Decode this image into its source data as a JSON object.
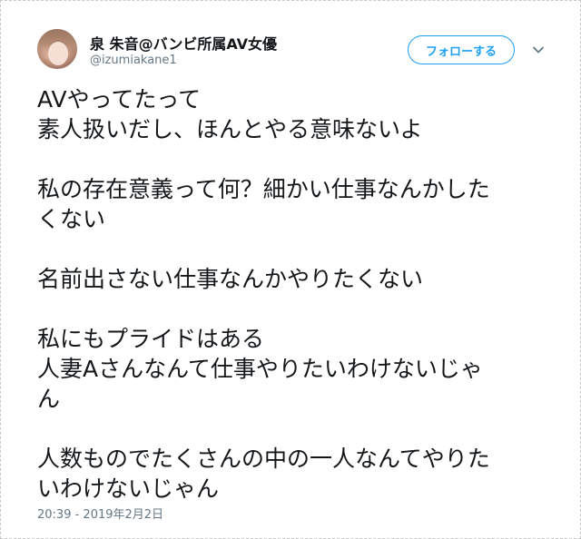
{
  "author": {
    "display_name": "泉 朱音@バンビ所属AV女優",
    "handle": "@izumiakane1"
  },
  "header": {
    "follow_label": "フォローする",
    "menu_icon": "chevron-down-icon"
  },
  "tweet": {
    "paragraphs": [
      [
        "AVやってたって",
        "素人扱いだし、ほんとやる意味ないよ"
      ],
      [
        "私の存在意義って何？細かい仕事なんかした",
        "くない"
      ],
      [
        "名前出さない仕事なんかやりたくない"
      ],
      [
        "私にもプライドはある",
        "人妻Aさんなんて仕事やりたいわけないじゃ",
        "ん"
      ],
      [
        "人数ものでたくさんの中の一人なんてやりた",
        "いわけないじゃん"
      ]
    ],
    "timestamp": "20:39 - 2019年2月2日"
  },
  "colors": {
    "accent": "#1da1f2",
    "text": "#14171a",
    "secondary": "#657786"
  }
}
